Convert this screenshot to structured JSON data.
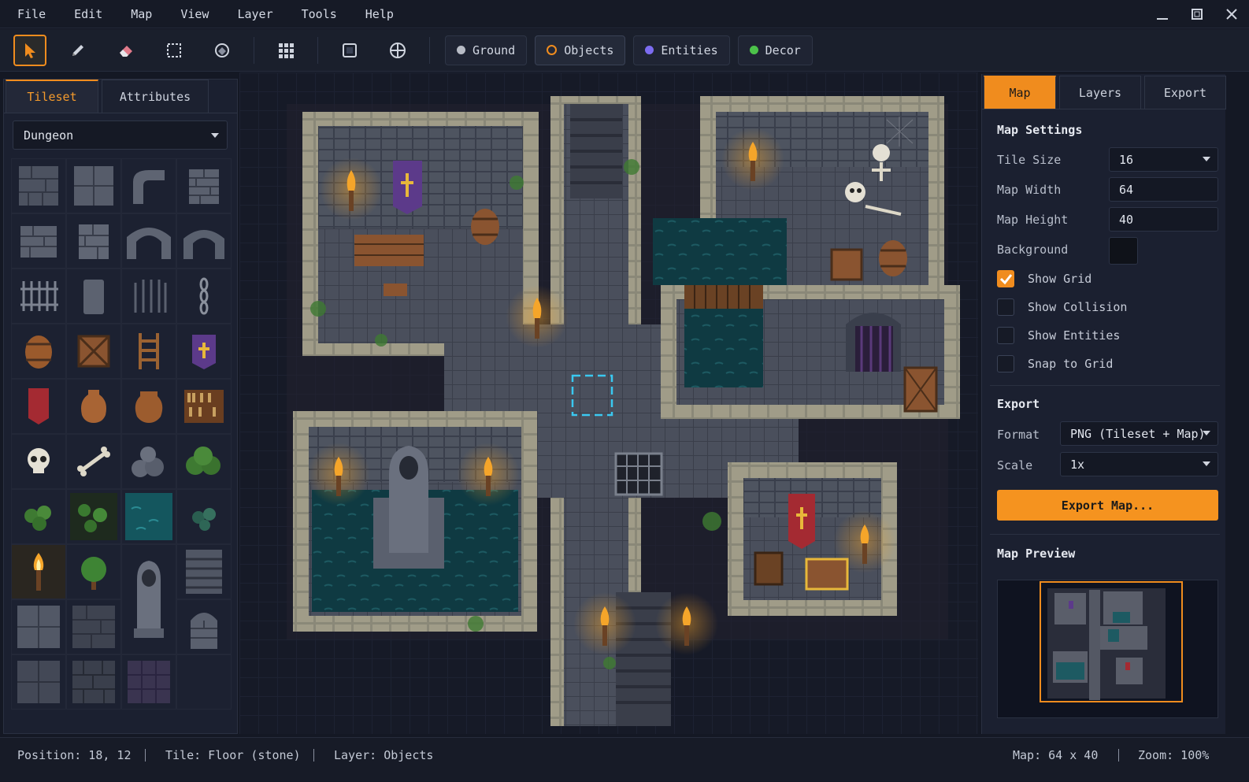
{
  "menu": [
    "File",
    "Edit",
    "Map",
    "View",
    "Layer",
    "Tools",
    "Help"
  ],
  "layers": [
    {
      "label": "Ground",
      "color": "#b8bcc6",
      "ring": false
    },
    {
      "label": "Objects",
      "color": "#f08c1e",
      "ring": true
    },
    {
      "label": "Entities",
      "color": "#7c6cf0",
      "ring": false
    },
    {
      "label": "Decor",
      "color": "#4cc24a",
      "ring": false
    }
  ],
  "left_panel": {
    "tabs": [
      "Tileset",
      "Attributes"
    ],
    "tileset": "Dungeon"
  },
  "right_panel": {
    "tabs": [
      "Map",
      "Layers",
      "Export"
    ],
    "map_settings_title": "Map Settings",
    "tile_size_label": "Tile Size",
    "tile_size": "16",
    "map_width_label": "Map Width",
    "map_width": "64",
    "map_height_label": "Map Height",
    "map_height": "40",
    "background_label": "Background",
    "background_color": "#0f1219",
    "checks": [
      {
        "label": "Show Grid",
        "checked": true
      },
      {
        "label": "Show Collision",
        "checked": false
      },
      {
        "label": "Show Entities",
        "checked": false
      },
      {
        "label": "Snap to Grid",
        "checked": false
      }
    ],
    "export_title": "Export",
    "format_label": "Format",
    "format": "PNG (Tileset + Map)",
    "scale_label": "Scale",
    "scale": "1x",
    "export_button": "Export Map...",
    "preview_title": "Map Preview"
  },
  "status": {
    "position": "Position: 18, 12",
    "tile": "Tile: Floor (stone)",
    "layer": "Layer: Objects",
    "map": "Map: 64 x 40",
    "zoom": "Zoom: 100%"
  },
  "accent": "#f08c1e"
}
